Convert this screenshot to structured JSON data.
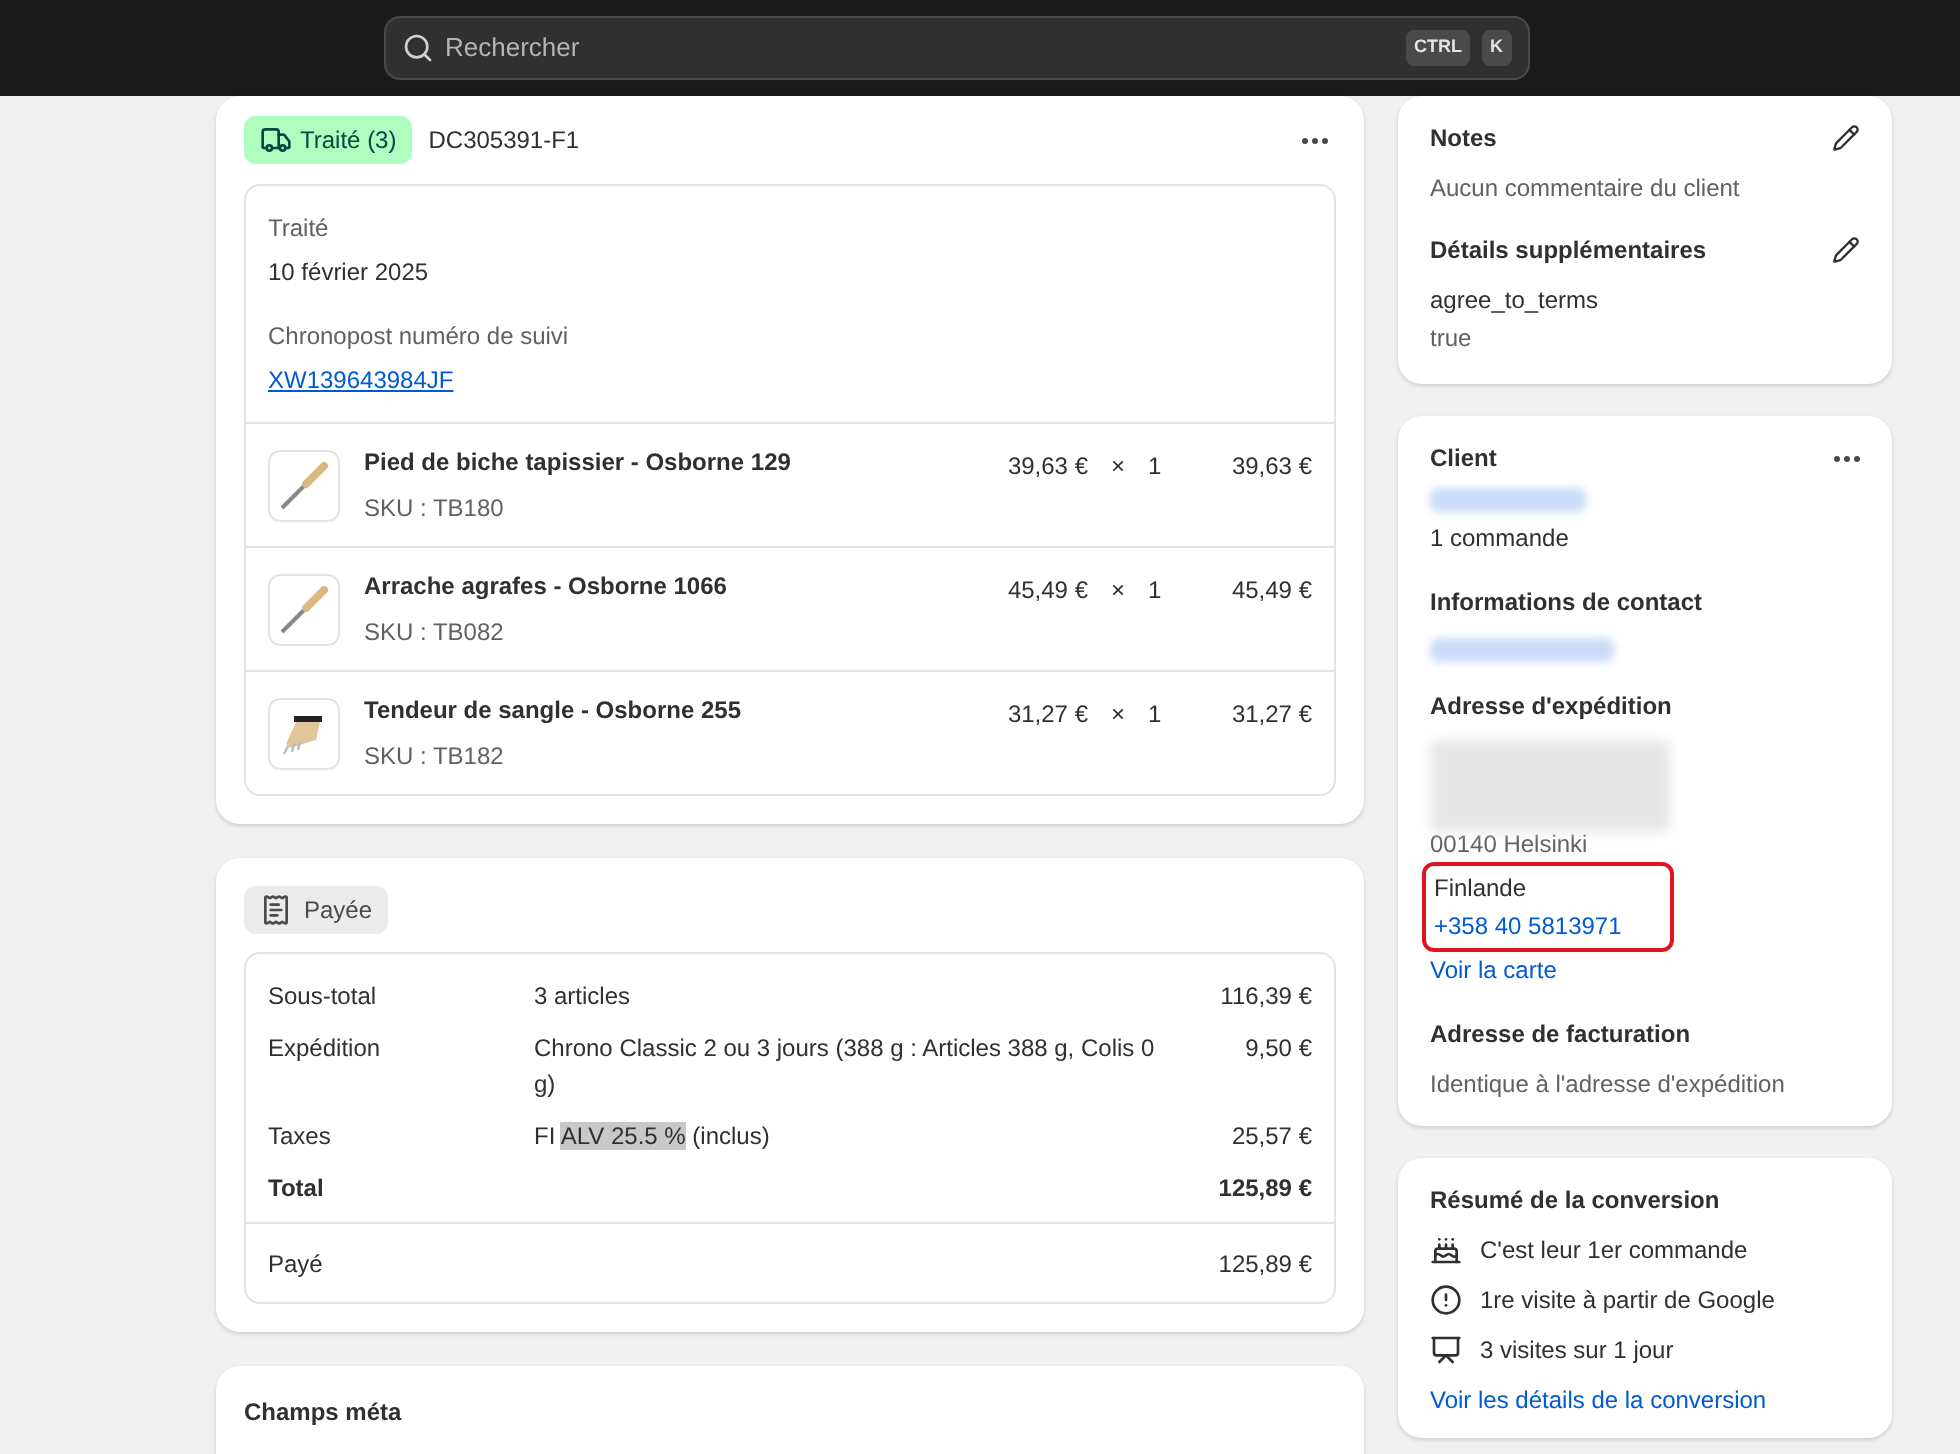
{
  "search": {
    "placeholder": "Rechercher",
    "shortcut": [
      "CTRL",
      "K"
    ]
  },
  "fulfillment": {
    "badge": "Traité (3)",
    "order_id": "DC305391-F1",
    "status_label": "Traité",
    "date": "10 février 2025",
    "tracking_label": "Chronopost numéro de suivi",
    "tracking_number": "XW139643984JF",
    "items": [
      {
        "name": "Pied de biche tapissier - Osborne 129",
        "sku": "SKU : TB180",
        "price": "39,63 €",
        "times": "×",
        "qty": "1",
        "total": "39,63 €",
        "kind": "bar"
      },
      {
        "name": "Arrache agrafes - Osborne 1066",
        "sku": "SKU : TB082",
        "price": "45,49 €",
        "times": "×",
        "qty": "1",
        "total": "45,49 €",
        "kind": "bar"
      },
      {
        "name": "Tendeur de sangle - Osborne 255",
        "sku": "SKU : TB182",
        "price": "31,27 €",
        "times": "×",
        "qty": "1",
        "total": "31,27 €",
        "kind": "comb"
      }
    ]
  },
  "payment": {
    "badge": "Payée",
    "rows": [
      {
        "label": "Sous-total",
        "detail": "3 articles",
        "amount": "116,39 €",
        "bold": false
      },
      {
        "label": "Expédition",
        "detail": "Chrono Classic 2 ou 3 jours (388 g : Articles 388 g, Colis 0 g)",
        "amount": "9,50 €",
        "bold": false
      },
      {
        "label": "Taxes",
        "detail_prefix": "FI",
        "detail_highlight": "ALV 25.5 %",
        "detail_suffix": "(inclus)",
        "amount": "25,57 €",
        "bold": false
      },
      {
        "label": "Total",
        "amount": "125,89 €",
        "bold": true
      }
    ],
    "paid": {
      "label": "Payé",
      "amount": "125,89 €"
    }
  },
  "metafields": {
    "title": "Champs méta"
  },
  "notes": {
    "title": "Notes",
    "text": "Aucun commentaire du client",
    "extra_title": "Détails supplémentaires",
    "extra_key": "agree_to_terms",
    "extra_value": "true"
  },
  "client": {
    "title": "Client",
    "orders": "1 commande",
    "contact_title": "Informations de contact",
    "shipping_title": "Adresse d'expédition",
    "address_visible": "00140 Helsinki",
    "country": "Finlande",
    "phone": "+358 40 5813971",
    "map_link": "Voir la carte",
    "billing_title": "Adresse de facturation",
    "billing_text": "Identique à l'adresse d'expédition"
  },
  "conversion": {
    "title": "Résumé de la conversion",
    "items": [
      {
        "kind": "cake",
        "text": "C'est leur 1er commande"
      },
      {
        "kind": "first",
        "text": "1re visite à partir de Google"
      },
      {
        "kind": "board",
        "text": "3 visites sur 1 jour"
      }
    ],
    "link": "Voir les détails de la conversion"
  }
}
